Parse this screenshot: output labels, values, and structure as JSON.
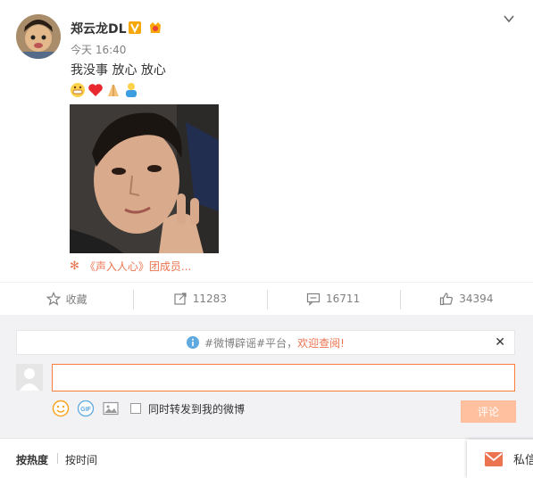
{
  "post": {
    "username": "郑云龙DL",
    "timestamp": "今天 16:40",
    "text": "我没事 放心 放心",
    "emojis": [
      "grin-emoji",
      "heart-emoji",
      "pray-emoji",
      "hug-emoji"
    ],
    "source": "《声入人心》团成员..."
  },
  "actions": {
    "favorite": "收藏",
    "repost_count": "11283",
    "comment_count": "16711",
    "like_count": "34394"
  },
  "comment_box": {
    "notice_text": "#微博辟谣#平台，",
    "notice_highlight": "欢迎查阅!",
    "input_value": "",
    "repost_label": "同时转发到我的微博",
    "submit_label": "评论"
  },
  "sort": {
    "hot": "按热度",
    "time": "按时间"
  },
  "message": {
    "label": "私信"
  },
  "colors": {
    "accent": "#eb7350",
    "input_border": "#fa7d3c",
    "submit_bg": "#ffc09f",
    "verified_badge": "#f7a707"
  }
}
